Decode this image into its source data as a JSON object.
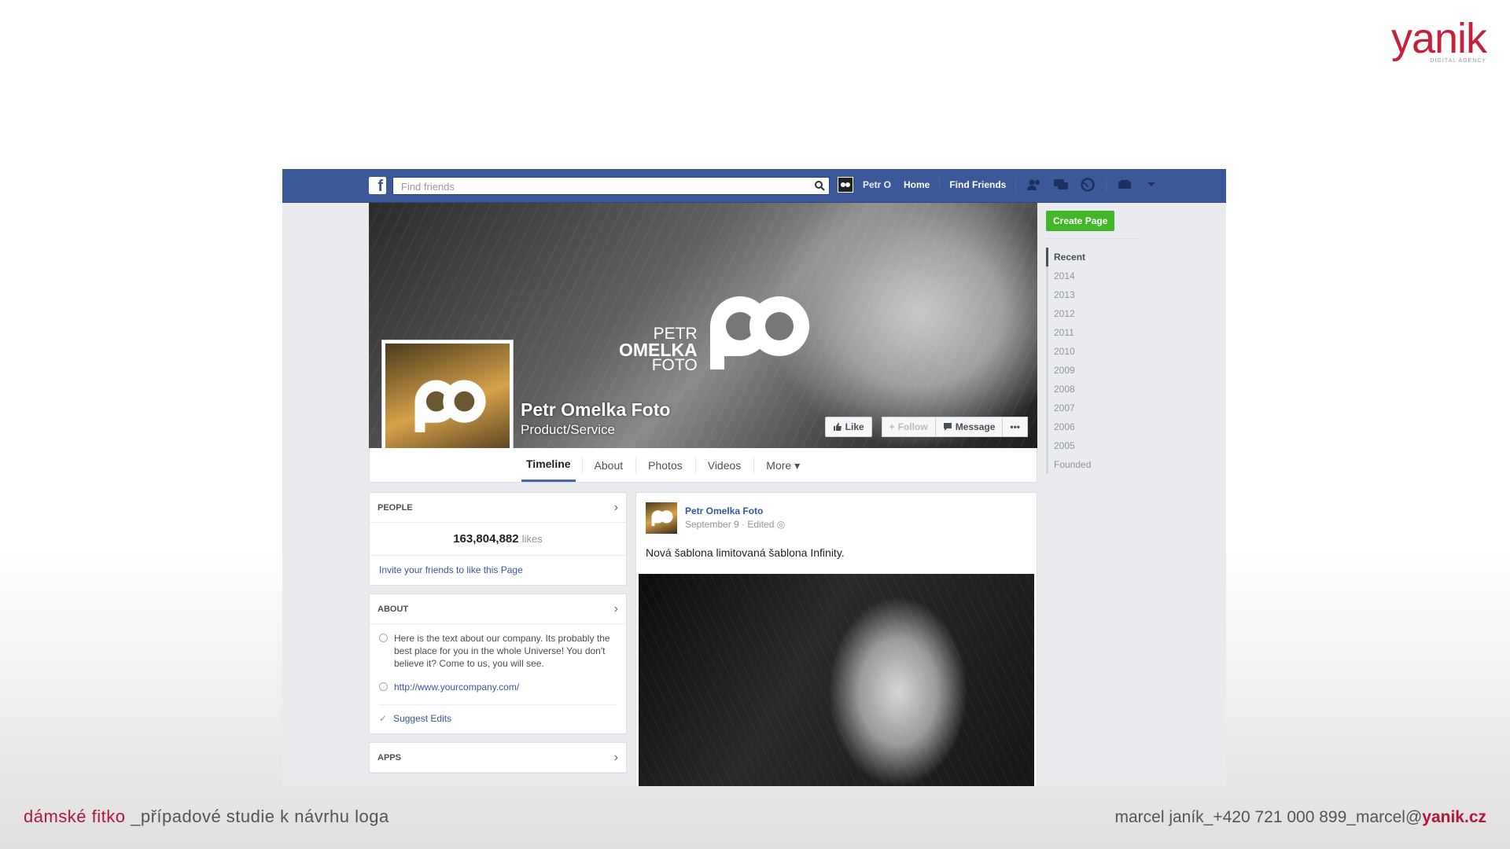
{
  "brand": {
    "logo_word": "yanik",
    "logo_sub": "DIGITAL AGENCY"
  },
  "topbar": {
    "search_placeholder": "Find friends",
    "user_name": "Petr O",
    "home": "Home",
    "find_friends": "Find Friends"
  },
  "cover": {
    "logo_line1": "PETR",
    "logo_line2": "OMELKA",
    "logo_line3": "FOTO",
    "page_name": "Petr Omelka Foto",
    "category": "Product/Service",
    "btn_like": "Like",
    "btn_follow": "Follow",
    "btn_message": "Message",
    "btn_more": "•••"
  },
  "tabs": [
    "Timeline",
    "About",
    "Photos",
    "Videos",
    "More"
  ],
  "people": {
    "header": "PEOPLE",
    "likes_count": "163,804,882",
    "likes_label": "likes",
    "invite": "Invite your friends to like this Page"
  },
  "about": {
    "header": "ABOUT",
    "text": "Here is the text about our company. Its probably the best place for you in the whole Universe! You don't believe it? Come to us, you will see.",
    "url": "http://www.yourcompany.com/",
    "suggest": "Suggest Edits"
  },
  "apps": {
    "header": "APPS"
  },
  "post": {
    "author": "Petr Omelka Foto",
    "meta": "September 9 · Edited",
    "text": "Nová šablona limitovaná šablona Infinity."
  },
  "rail": {
    "create_page": "Create Page",
    "years": [
      "Recent",
      "2014",
      "2013",
      "2012",
      "2011",
      "2010",
      "2009",
      "2008",
      "2007",
      "2006",
      "2005",
      "Founded"
    ]
  },
  "footer": {
    "left_accent": "dámské fitko",
    "left_rest": " _případové studie k návrhu loga",
    "right_rest": "marcel janík_+420 721 000 899_marcel@",
    "right_accent": "yanik.cz"
  },
  "colors": {
    "fb_blue": "#3b5998",
    "brand_red": "#c4213c",
    "green": "#42b72a"
  }
}
